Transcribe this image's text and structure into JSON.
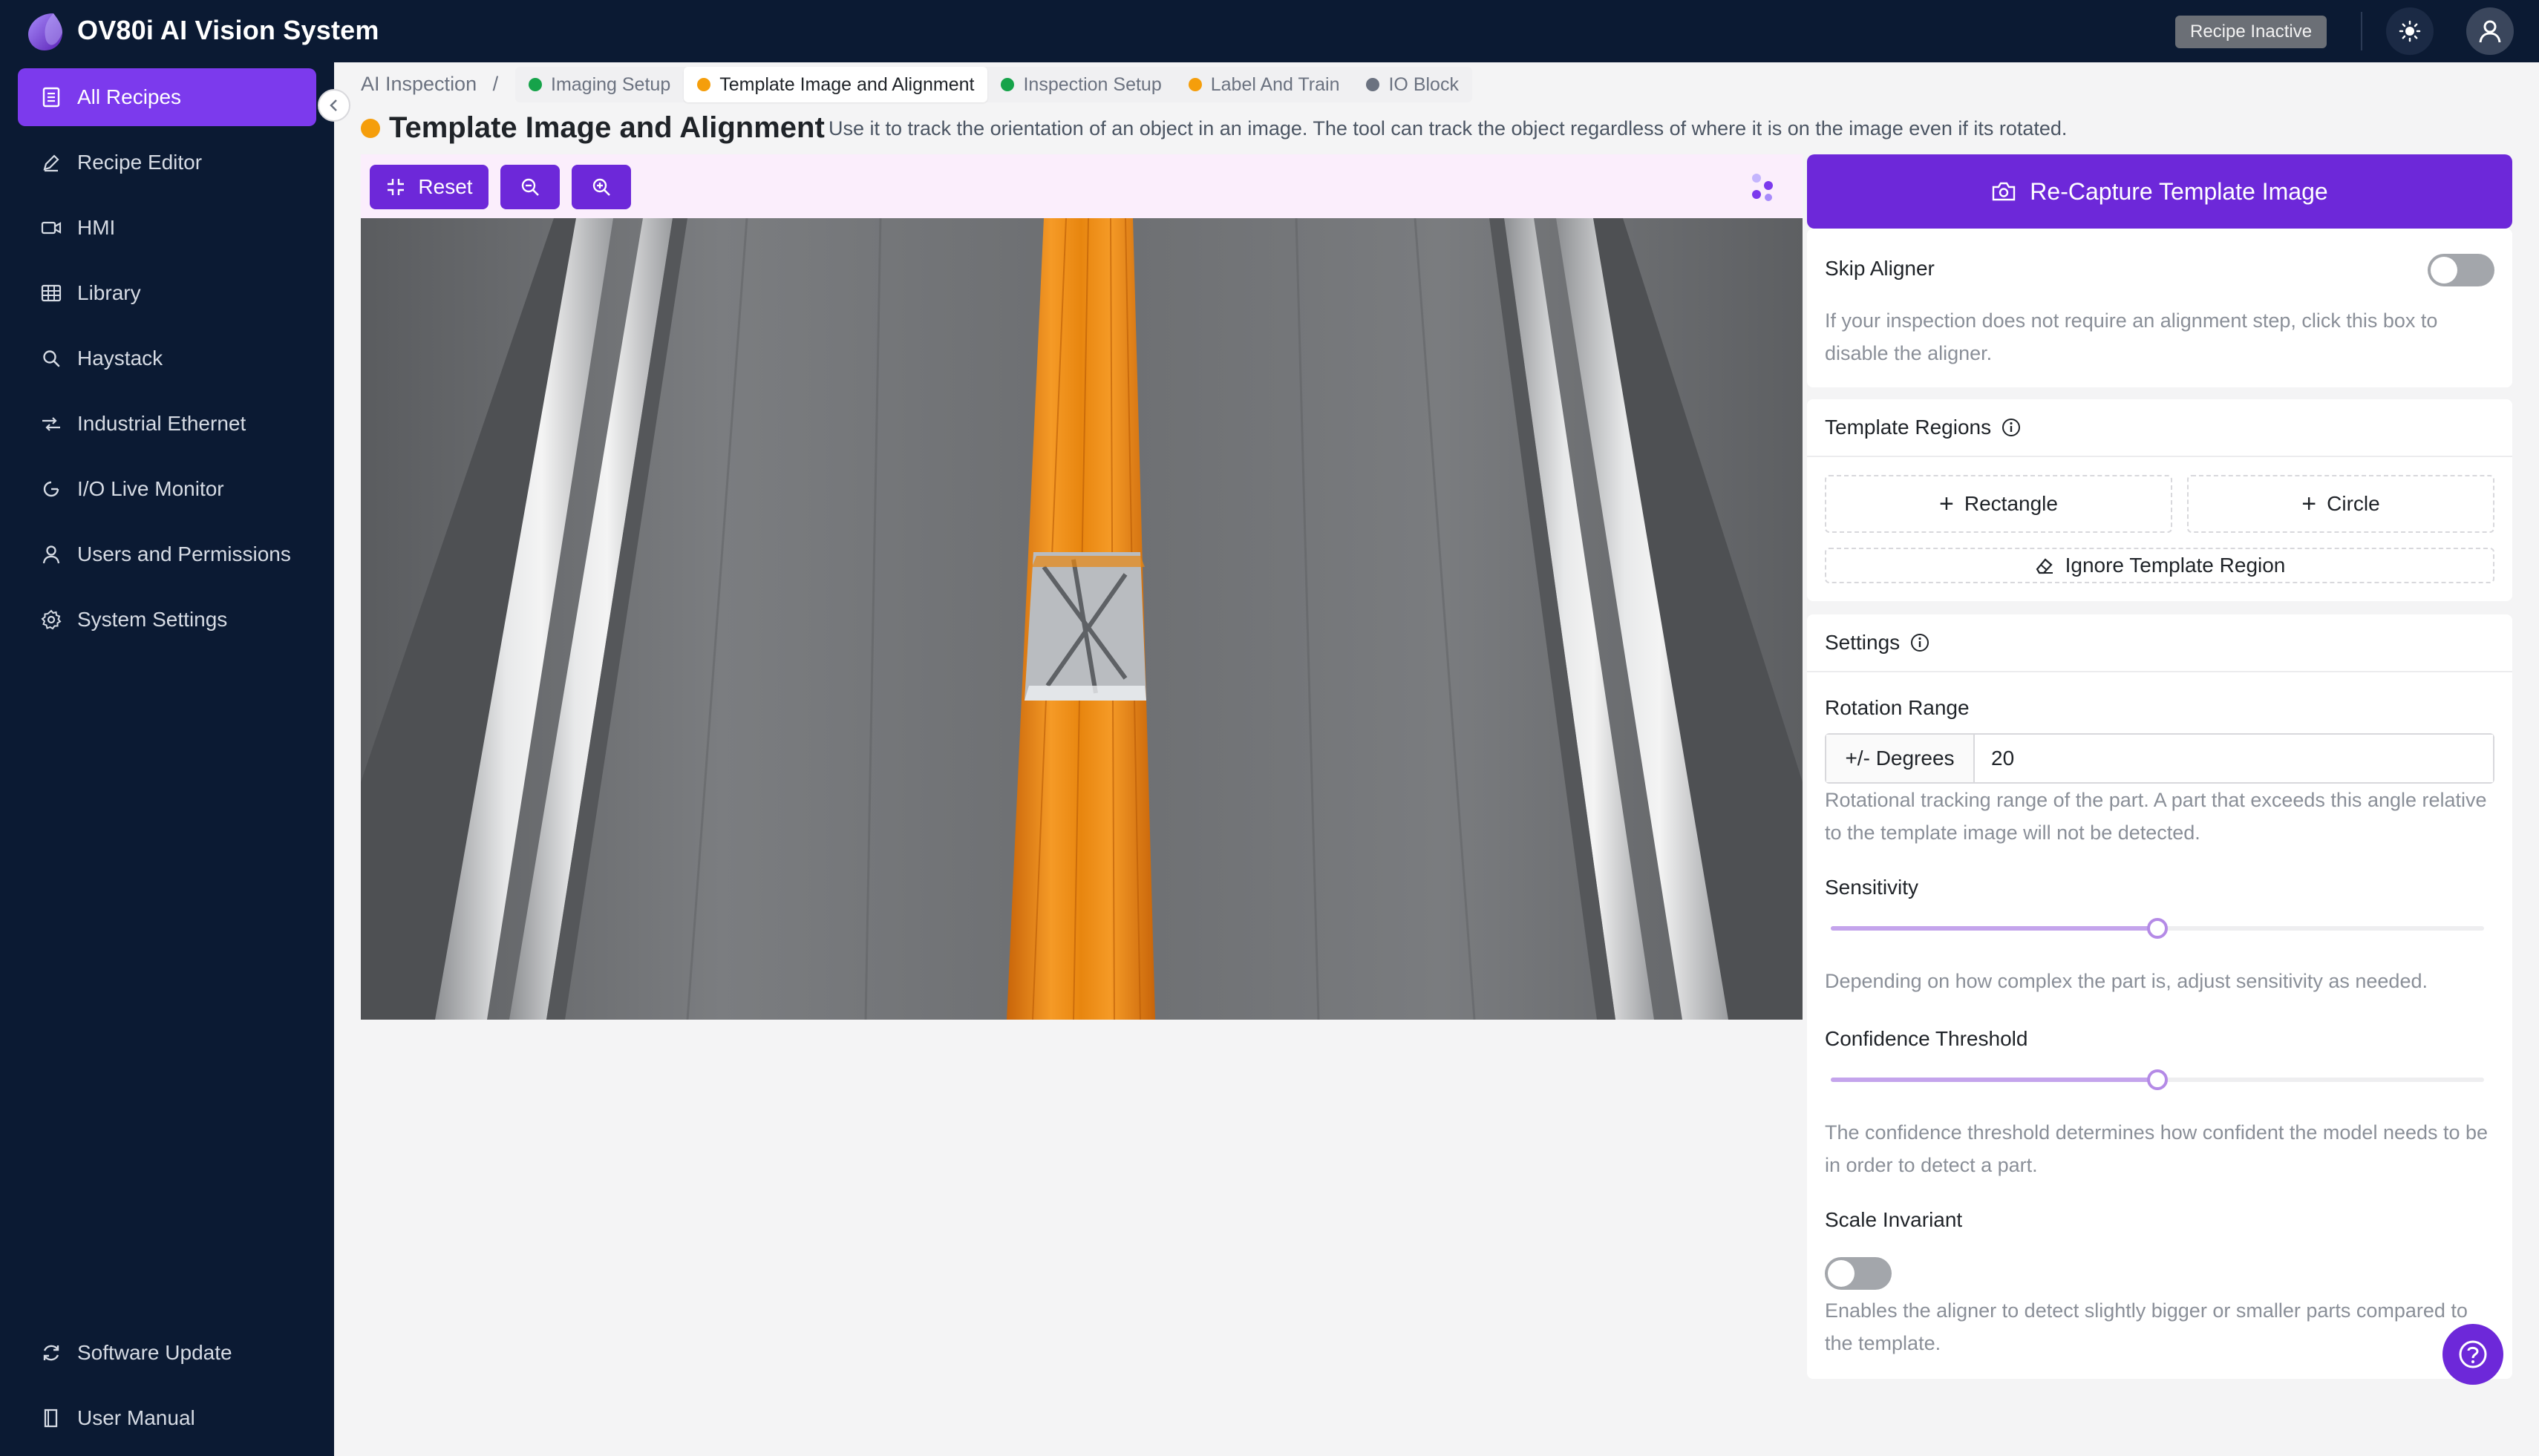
{
  "app": {
    "title": "OV80i AI Vision System",
    "recipe_status": "Recipe Inactive"
  },
  "sidebar": {
    "items": [
      {
        "label": "All Recipes",
        "icon": "document-icon",
        "active": true
      },
      {
        "label": "Recipe Editor",
        "icon": "pencil-icon"
      },
      {
        "label": "HMI",
        "icon": "camera-icon"
      },
      {
        "label": "Library",
        "icon": "table-icon"
      },
      {
        "label": "Haystack",
        "icon": "search-icon"
      },
      {
        "label": "Industrial Ethernet",
        "icon": "ethernet-icon"
      },
      {
        "label": "I/O Live Monitor",
        "icon": "gauge-icon"
      },
      {
        "label": "Users and Permissions",
        "icon": "user-icon"
      },
      {
        "label": "System Settings",
        "icon": "gear-icon"
      }
    ],
    "bottom_items": [
      {
        "label": "Software Update",
        "icon": "refresh-icon"
      },
      {
        "label": "User Manual",
        "icon": "book-icon"
      }
    ]
  },
  "breadcrumb": {
    "root": "AI Inspection",
    "separator": "/",
    "steps": [
      {
        "label": "Imaging Setup",
        "status_color": "#16a34a"
      },
      {
        "label": "Template Image and Alignment",
        "status_color": "#f59e0b",
        "current": true
      },
      {
        "label": "Inspection Setup",
        "status_color": "#16a34a"
      },
      {
        "label": "Label And Train",
        "status_color": "#f59e0b"
      },
      {
        "label": "IO Block",
        "status_color": "#6b7280"
      }
    ]
  },
  "page": {
    "title": "Template Image and Alignment",
    "status_color": "#f59e0b",
    "description": "Use it to track the orientation of an object in an image. The tool can track the object regardless of where it is on the image even if its rotated."
  },
  "viewer": {
    "reset_label": "Reset",
    "zoom_out_icon": "zoom-out-icon",
    "zoom_in_icon": "zoom-in-icon"
  },
  "panel": {
    "recapture_label": "Re-Capture Template Image",
    "skip_aligner": {
      "label": "Skip Aligner",
      "enabled": false,
      "help": "If your inspection does not require an alignment step, click this box to disable the aligner."
    },
    "template_regions": {
      "title": "Template Regions",
      "rectangle_label": "Rectangle",
      "circle_label": "Circle",
      "ignore_label": "Ignore Template Region"
    },
    "settings": {
      "title": "Settings",
      "rotation_range": {
        "label": "Rotation Range",
        "unit_label": "+/- Degrees",
        "value": "20",
        "help": "Rotational tracking range of the part. A part that exceeds this angle relative to the template image will not be detected."
      },
      "sensitivity": {
        "label": "Sensitivity",
        "value": 0.5,
        "help": "Depending on how complex the part is, adjust sensitivity as needed."
      },
      "confidence_threshold": {
        "label": "Confidence Threshold",
        "value": 0.5,
        "help": "The confidence threshold determines how confident the model needs to be in order to detect a part."
      },
      "scale_invariant": {
        "label": "Scale Invariant",
        "enabled": false,
        "help": "Enables the aligner to detect slightly bigger or smaller parts compared to the template."
      }
    }
  },
  "colors": {
    "accent": "#6d28d9",
    "active_nav": "#7c3aed",
    "header_bg": "#0b1a33"
  }
}
